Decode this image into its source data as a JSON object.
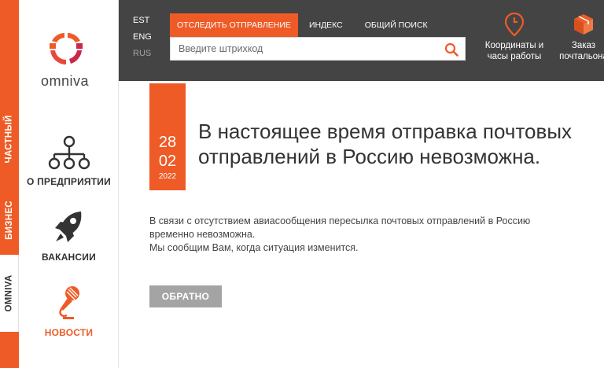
{
  "vertical_tabs": [
    "ЧАСТНЫЙ",
    "БИЗНЕС",
    "OMNIVA"
  ],
  "logo": {
    "text": "omniva"
  },
  "sidebar": {
    "items": [
      {
        "label": "О ПРЕДПРИЯТИИ",
        "icon": "org-chart-icon"
      },
      {
        "label": "ВАКАНСИИ",
        "icon": "rocket-icon"
      },
      {
        "label": "НОВОСТИ",
        "icon": "microphone-icon"
      }
    ]
  },
  "header": {
    "languages": [
      "EST",
      "ENG",
      "RUS"
    ],
    "tabs": [
      "ОТСЛЕДИТЬ ОТПРАВЛЕНИЕ",
      "ИНДЕКС",
      "ОБЩИЙ ПОИСК"
    ],
    "search_placeholder": "Введите штрихкод",
    "buttons": [
      {
        "line1": "Координаты и",
        "line2": "часы работы",
        "icon": "location-clock-icon"
      },
      {
        "line1": "Заказ",
        "line2": "почтальона",
        "icon": "parcel-box-icon"
      }
    ]
  },
  "main": {
    "date": {
      "day": "28",
      "month": "02",
      "year": "2022"
    },
    "headline": "В настоящее время отправка почтовых отправлений в Россию невозможна.",
    "body_line1": "В связи с отсутствием авиасообщения пересылка почтовых отправлений в Россию",
    "body_line2": "временно невозможна.",
    "body_line3": "Мы сообщим Вам, когда ситуация изменится.",
    "back_button": "ОБРАТНО"
  },
  "colors": {
    "accent": "#ee5b26",
    "header_bg": "#444444",
    "button_gray": "#a4a4a4"
  }
}
